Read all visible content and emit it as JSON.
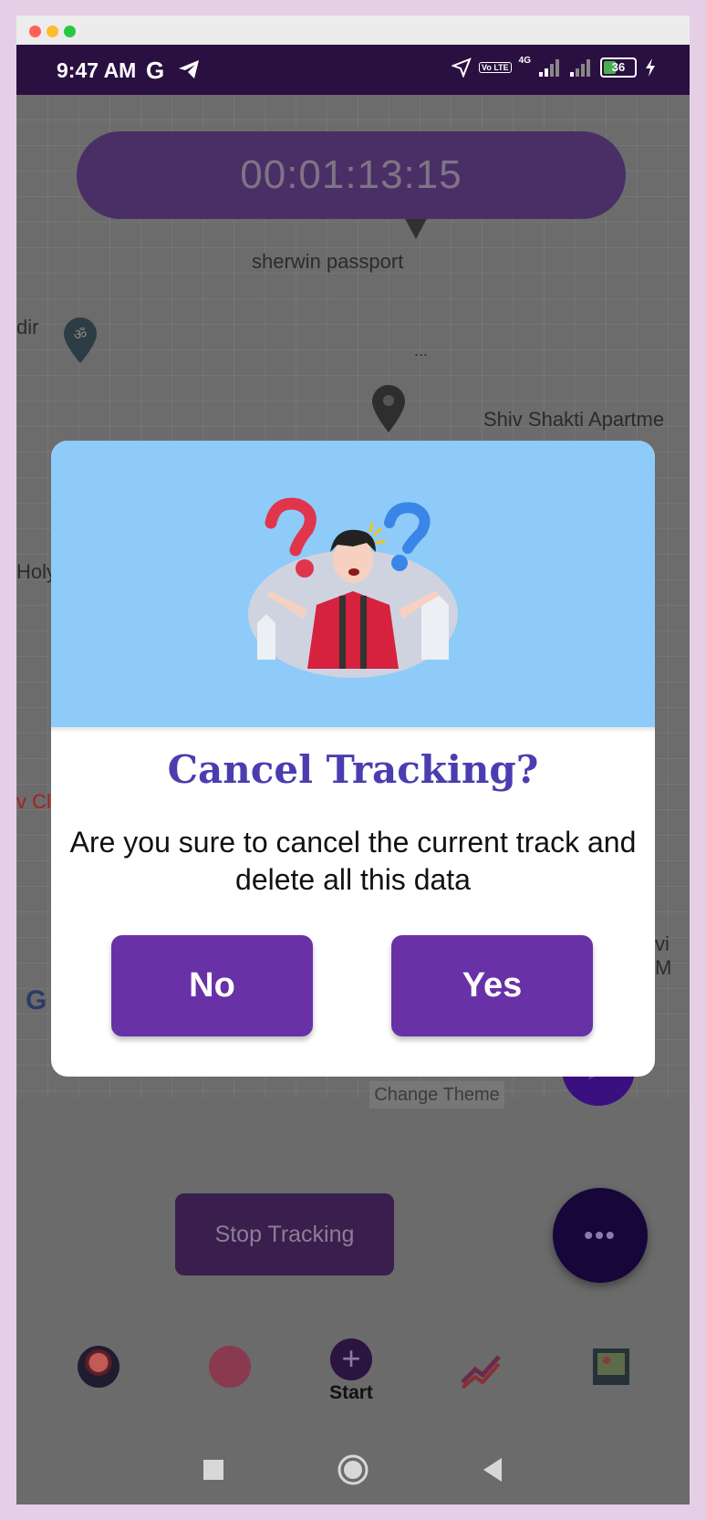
{
  "status_bar": {
    "time": "9:47 AM",
    "g_icon": "G",
    "volte": "Vo LTE",
    "network": "4G",
    "battery": "36"
  },
  "timer": "00:01:13:15",
  "map": {
    "labels": [
      "sherwin passport",
      "dir",
      "Shiv Shakti Apartme",
      "Holy",
      "v Cl",
      "vi M",
      "G",
      "..."
    ],
    "change_theme": "Change Theme"
  },
  "dialog": {
    "title": "Cancel Tracking?",
    "message": "Are you sure to cancel the current track and delete all this data",
    "no_label": "No",
    "yes_label": "Yes"
  },
  "controls": {
    "stop_tracking": "Stop Tracking",
    "more": "•••",
    "start": "Start",
    "start_plus": "+"
  },
  "colors": {
    "accent": "#6831a6",
    "title": "#4b3db0",
    "hero_bg": "#8ecbf8",
    "status_bar": "#2a1040"
  }
}
